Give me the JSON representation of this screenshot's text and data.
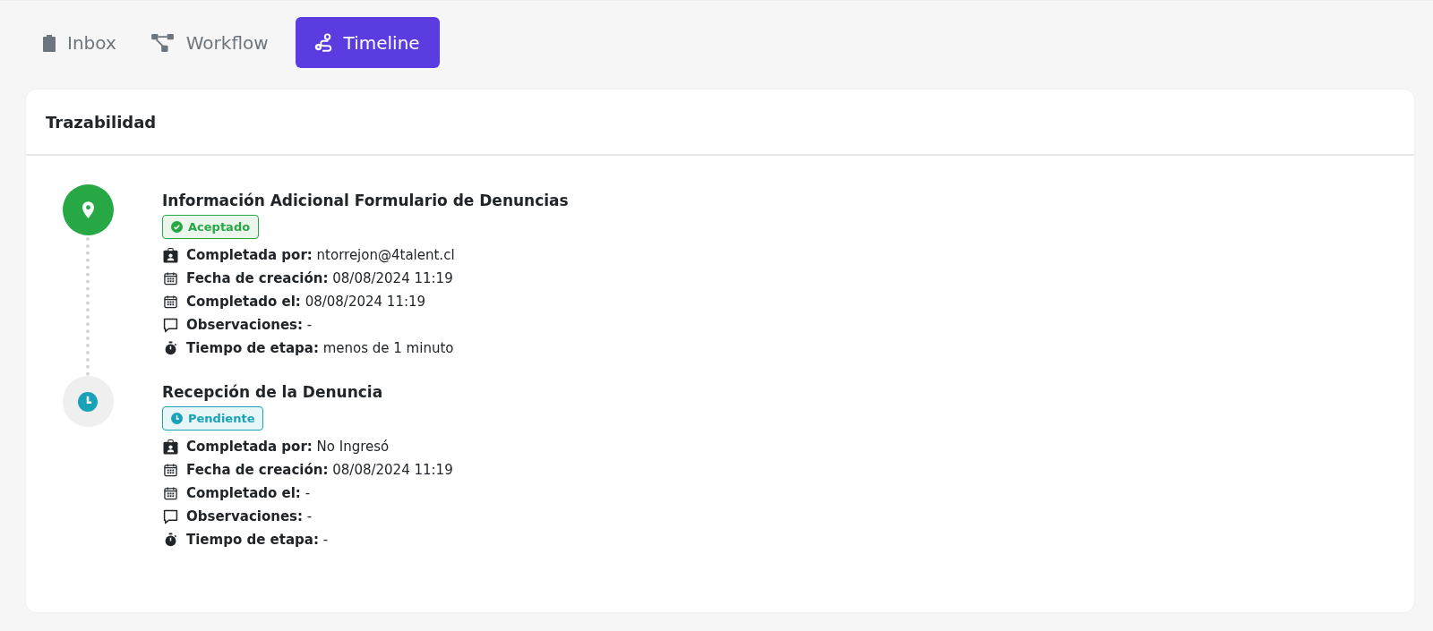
{
  "tabs": [
    {
      "label": "Inbox",
      "kind": "clipboard",
      "selected": false
    },
    {
      "label": "Workflow",
      "kind": "flow",
      "selected": false
    },
    {
      "label": "Timeline",
      "kind": "route",
      "selected": true
    }
  ],
  "card": {
    "title": "Trazabilidad",
    "events": [
      {
        "title": "Información Adicional Formulario de Denuncias",
        "status": {
          "kind": "accepted",
          "label": "Aceptado"
        },
        "details": [
          {
            "kind": "user",
            "text": "**Completada por:** ntorrejon@4talent.cl"
          },
          {
            "kind": "calendar",
            "text": "**Fecha de creación:** 08/08/2024 11:19"
          },
          {
            "kind": "calendar",
            "text": "**Completado el:** 08/08/2024 11:19"
          },
          {
            "kind": "comment",
            "text": "**Observaciones:** -"
          },
          {
            "kind": "timer",
            "text": "**Tiempo de etapa:** menos de 1 minuto"
          }
        ]
      },
      {
        "title": "Recepción de la Denuncia",
        "status": {
          "kind": "pending",
          "label": "Pendiente"
        },
        "details": [
          {
            "kind": "user",
            "text": "**Completada por:** No Ingresó"
          },
          {
            "kind": "calendar",
            "text": "**Fecha de creación:** 08/08/2024 11:19"
          },
          {
            "kind": "calendar",
            "text": "**Completado el:** -"
          },
          {
            "kind": "comment",
            "text": "**Observaciones:** -"
          },
          {
            "kind": "timer",
            "text": "**Tiempo de etapa:** -"
          }
        ]
      }
    ]
  }
}
